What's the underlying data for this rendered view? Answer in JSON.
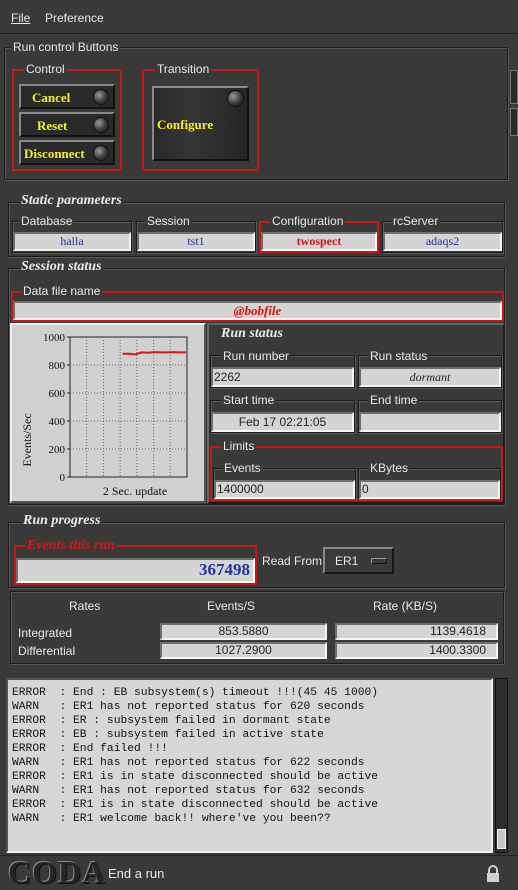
{
  "menu": {
    "file": "File",
    "preference": "Preference"
  },
  "run_control": {
    "title": "Run control Buttons",
    "control_title": "Control",
    "transition_title": "Transition",
    "cancel": "Cancel",
    "reset": "Reset",
    "disconnect": "Disconnect",
    "configure": "Configure"
  },
  "static": {
    "title": "Static parameters",
    "database_label": "Database",
    "database": "halla",
    "session_label": "Session",
    "session": "tst1",
    "configuration_label": "Configuration",
    "configuration": "twospect",
    "rcserver_label": "rcServer",
    "rcserver": "adaqs2"
  },
  "session_status": {
    "title": "Session status",
    "datafile_label": "Data file name",
    "datafile": "@bobfile"
  },
  "chart_data": {
    "type": "line",
    "ylabel": "Events/Sec",
    "xlabel": "2 Sec. update",
    "ylim": [
      0,
      1000
    ],
    "yticks": [
      "1000",
      "800",
      "600",
      "400",
      "200",
      "0"
    ],
    "series": [
      {
        "values": [
          880,
          880,
          875,
          890,
          888,
          892,
          890,
          890,
          892,
          890,
          890
        ]
      }
    ],
    "line_color": "#d01818"
  },
  "run_status": {
    "title": "Run status",
    "run_number_label": "Run number",
    "run_number": "2262",
    "run_status_label": "Run status",
    "run_status": "dormant",
    "start_time_label": "Start time",
    "start_time": "Feb 17 02:21:05",
    "end_time_label": "End time",
    "end_time": "",
    "limits_label": "Limits",
    "events_label": "Events",
    "events": "1400000",
    "kbytes_label": "KBytes",
    "kbytes": "0"
  },
  "run_progress": {
    "title": "Run progress",
    "events_label": "Events this run",
    "events": "367498",
    "read_from_label": "Read From:",
    "read_from": "ER1",
    "rates_header": "Rates",
    "events_header": "Events/S",
    "rate_header": "Rate (KB/S)",
    "integrated_label": "Integrated",
    "integrated_events": "853.5880",
    "integrated_rate": "1139.4618",
    "differential_label": "Differential",
    "differential_events": "1027.2900",
    "differential_rate": "1400.3300"
  },
  "log_lines": [
    "ERROR  : End : EB subsystem(s) timeout !!!(45 45 1000)",
    "WARN   : ER1 has not reported status for 620 seconds",
    "ERROR  : ER : subsystem failed in dormant state",
    "ERROR  : EB : subsystem failed in active state",
    "ERROR  : End failed !!!",
    "WARN   : ER1 has not reported status for 622 seconds",
    "ERROR  : ER1 is in state disconnected should be active",
    "WARN   : ER1 has not reported status for 632 seconds",
    "ERROR  : ER1 is in state disconnected should be active",
    "WARN   : ER1 welcome back!! where've you been??"
  ],
  "footer": {
    "logo": "CODA",
    "status": "End a run"
  }
}
